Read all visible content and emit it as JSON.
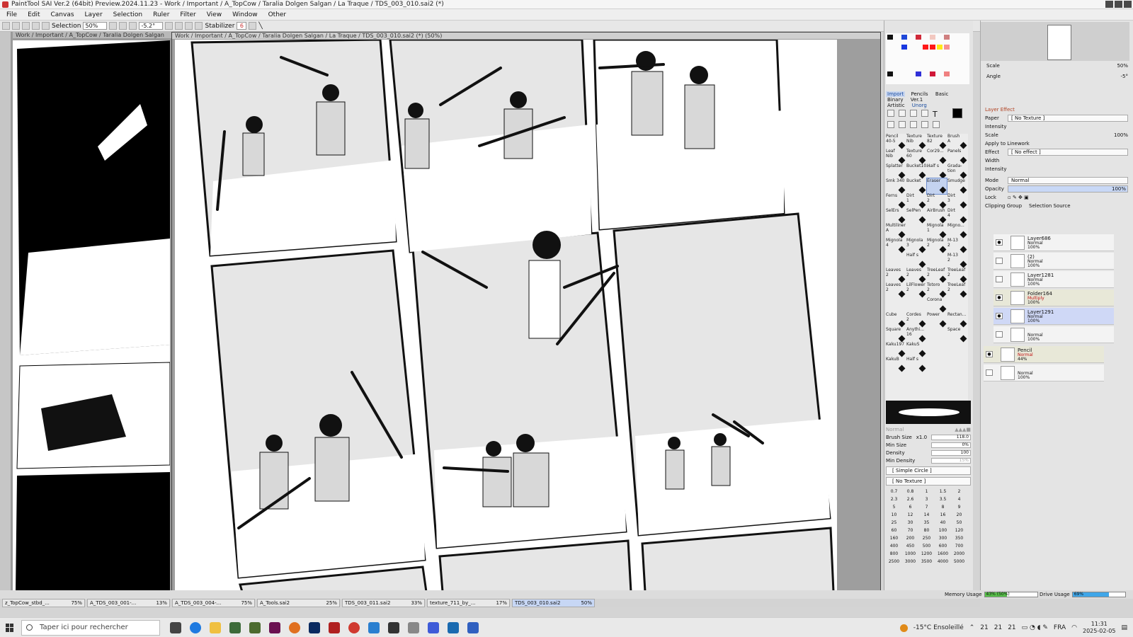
{
  "titlebar": {
    "title": "PaintTool SAI Ver.2 (64bit) Preview.2024.11.23 - Work / Important / A_TopCow / Taralia Dolgen Salgan / La Traque / TDS_003_010.sai2 (*)"
  },
  "menu": [
    "File",
    "Edit",
    "Canvas",
    "Layer",
    "Selection",
    "Ruler",
    "Filter",
    "View",
    "Window",
    "Other"
  ],
  "toolbar": {
    "selection_label": "Selection",
    "zoom": "50%",
    "angle": "-5.2°",
    "stabilizer_label": "Stabilizer",
    "stabilizer_value": "6"
  },
  "left_doc": {
    "header": "Work / Important / A_TopCow / Taralia Dolgen Salgan"
  },
  "main_doc": {
    "header": "Work / Important / A_TopCow / Taralia Dolgen Salgan / La Traque / TDS_003_010.sai2 (*) (50%)"
  },
  "colors": {
    "accent": "#2d5fd0",
    "selection": "#c4d3f0",
    "ink": "#111111",
    "screen_tone": "#e6e6e6"
  },
  "tool_tabs": [
    {
      "label": "Import",
      "active": true
    },
    {
      "label": "Pencils",
      "active": false
    },
    {
      "label": "Basic",
      "active": false
    },
    {
      "label": "Binary",
      "active": false
    },
    {
      "label": "Ver.1",
      "active": false
    },
    {
      "label": "Artistic",
      "active": false
    },
    {
      "label": "Unorg",
      "active": false
    }
  ],
  "brushes": [
    {
      "label": "Pencil\n40-5"
    },
    {
      "label": "Texture\nNib"
    },
    {
      "label": "Texture\n82"
    },
    {
      "label": "Brush\nA"
    },
    {
      "label": "Leaf\nNib"
    },
    {
      "label": "Texture\n60"
    },
    {
      "label": "Cor29..."
    },
    {
      "label": "Panels"
    },
    {
      "label": "Splatter"
    },
    {
      "label": "Bucket10..."
    },
    {
      "label": "Half s"
    },
    {
      "label": "Grada-\ntion"
    },
    {
      "label": "Smk 340"
    },
    {
      "label": "Bucket"
    },
    {
      "label": "Eraser",
      "selected": true
    },
    {
      "label": "Smudge"
    },
    {
      "label": "Ferns"
    },
    {
      "label": "Dirt\n1"
    },
    {
      "label": "Dirt\n2"
    },
    {
      "label": "Dirt\n3"
    },
    {
      "label": "SelErs"
    },
    {
      "label": "SelPen"
    },
    {
      "label": "AirBrush"
    },
    {
      "label": "Dirt\n4"
    },
    {
      "label": "Multiliner\nA"
    },
    {
      "label": ""
    },
    {
      "label": "Mignola\n1"
    },
    {
      "label": "Migno..."
    },
    {
      "label": "Mignola\n4"
    },
    {
      "label": "Mignola\n3"
    },
    {
      "label": "Mignola\n2"
    },
    {
      "label": "M-13\n2"
    },
    {
      "label": ""
    },
    {
      "label": "Half s"
    },
    {
      "label": ""
    },
    {
      "label": "M-13\n2"
    },
    {
      "label": "Leaves\n2"
    },
    {
      "label": "Leaves\n2"
    },
    {
      "label": "TreeLeaf\n2"
    },
    {
      "label": "TreeLeaf\n2"
    },
    {
      "label": "Leaves\n2"
    },
    {
      "label": "LilFlower\n2"
    },
    {
      "label": "Totoro\n2"
    },
    {
      "label": "TreeLeaf\n2"
    },
    {
      "label": ""
    },
    {
      "label": ""
    },
    {
      "label": "Corona"
    },
    {
      "label": ""
    },
    {
      "label": "Cube"
    },
    {
      "label": "Cordes\n2"
    },
    {
      "label": "Power"
    },
    {
      "label": "Rectan..."
    },
    {
      "label": "Square"
    },
    {
      "label": "Anythi...\n16"
    },
    {
      "label": ""
    },
    {
      "label": "Space"
    },
    {
      "label": "Kaku197"
    },
    {
      "label": "KakuS"
    },
    {
      "label": ""
    },
    {
      "label": ""
    },
    {
      "label": "KakuB"
    },
    {
      "label": "Half s"
    },
    {
      "label": ""
    },
    {
      "label": ""
    }
  ],
  "brush_props": {
    "blend_mode": "Normal",
    "size_label": "Brush Size",
    "size_mult": "x1.0",
    "size_value": "118.0",
    "min_size_label": "Min Size",
    "min_size_value": "0%",
    "density_label": "Density",
    "density_value": "100",
    "min_density_label": "Min Density",
    "min_density_value": "15%",
    "shape": "[ Simple Circle ]",
    "texture": "[ No Texture ]"
  },
  "size_presets": [
    "0.7",
    "0.8",
    "1",
    "1.5",
    "2",
    "2.3",
    "2.6",
    "3",
    "3.5",
    "4",
    "5",
    "6",
    "7",
    "8",
    "9",
    "10",
    "12",
    "14",
    "16",
    "20",
    "25",
    "30",
    "35",
    "40",
    "50",
    "60",
    "70",
    "80",
    "100",
    "120",
    "160",
    "200",
    "250",
    "300",
    "350",
    "400",
    "450",
    "500",
    "600",
    "700",
    "800",
    "1000",
    "1200",
    "1600",
    "2000",
    "2500",
    "3000",
    "3500",
    "4000",
    "5000"
  ],
  "navigator": {
    "scale_label": "Scale",
    "scale_value": "50%",
    "angle_label": "Angle",
    "angle_value": "-5°"
  },
  "layer_effect": {
    "header": "Layer Effect",
    "paper_label": "Paper",
    "paper_value": "[ No Texture ]",
    "intensity_label": "Intensity",
    "scale_label": "Scale",
    "scale_value": "100%",
    "apply_linework": "Apply to Linework",
    "effect_label": "Effect",
    "effect_value": "[ No effect ]",
    "width_label": "Width",
    "intensity2_label": "Intensity"
  },
  "layer_props": {
    "mode_label": "Mode",
    "mode_value": "Normal",
    "opacity_label": "Opacity",
    "opacity_value": "100%",
    "lock_label": "Lock",
    "clipping_label": "Clipping Group",
    "selection_source_label": "Selection Source"
  },
  "layers": [
    {
      "name": "Layer686",
      "mode": "Normal",
      "opacity": "100%",
      "visible": true
    },
    {
      "name": "(2)",
      "mode": "Normal",
      "opacity": "100%",
      "visible": false
    },
    {
      "name": "Layer1281",
      "mode": "Normal",
      "opacity": "100%",
      "visible": false
    },
    {
      "name": "Folder164",
      "mode": "Multiply",
      "opacity": "100%",
      "visible": true,
      "folder": true
    },
    {
      "name": "Layer1291",
      "mode": "Normal",
      "opacity": "100%",
      "visible": true,
      "selected": true
    },
    {
      "name": "",
      "mode": "Normal",
      "opacity": "100%",
      "visible": false
    },
    {
      "name": "Pencil",
      "mode": "Normal",
      "opacity": "44%",
      "visible": true,
      "folder": true
    },
    {
      "name": "",
      "mode": "Normal",
      "opacity": "100%",
      "visible": false
    }
  ],
  "usage": {
    "memory_label": "Memory Usage",
    "memory_value": "43% (50%)",
    "memory_fraction": 0.43,
    "drive_label": "Drive Usage",
    "drive_value": "69%",
    "drive_fraction": 0.69
  },
  "doc_tabs": [
    {
      "name": "z_TopCow_stbd_...",
      "zoom": "75%"
    },
    {
      "name": "A_TDS_003_001-...",
      "zoom": "13%"
    },
    {
      "name": "A_TDS_003_004-...",
      "zoom": "75%"
    },
    {
      "name": "A_Tools.sai2",
      "zoom": "25%"
    },
    {
      "name": "TDS_003_011.sai2",
      "zoom": "33%"
    },
    {
      "name": "texture_711_by_...",
      "zoom": "17%"
    },
    {
      "name": "TDS_003_010.sai2",
      "zoom": "50%",
      "active": true
    }
  ],
  "taskbar": {
    "search_placeholder": "Taper ici pour rechercher",
    "weather": "-15°C Ensoleillé",
    "tray_nums": [
      "21",
      "21",
      "21"
    ],
    "lang": "FRA",
    "time": "11:31",
    "date": "2025-02-05"
  }
}
